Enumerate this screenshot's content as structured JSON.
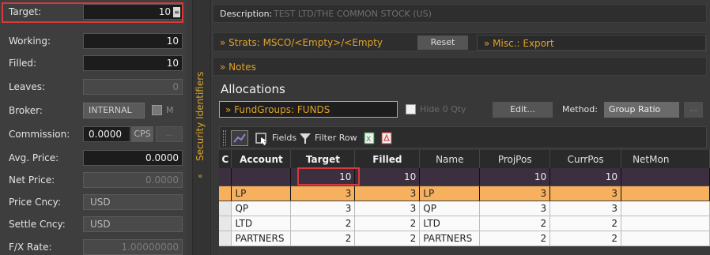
{
  "left_panel": {
    "target": {
      "label": "Target:",
      "value": "10",
      "btn": "≡"
    },
    "working": {
      "label": "Working:",
      "value": "10"
    },
    "filled": {
      "label": "Filled:",
      "value": "10"
    },
    "leaves": {
      "label": "Leaves:",
      "value": "0"
    },
    "broker": {
      "label": "Broker:",
      "value": "INTERNAL",
      "checkbox_label": "M"
    },
    "commission": {
      "label": "Commission:",
      "value": "0.0000",
      "unit": "CPS",
      "more": "..."
    },
    "avg_price": {
      "label": "Avg. Price:",
      "value": "0.0000"
    },
    "net_price": {
      "label": "Net Price:",
      "value": "0.0000"
    },
    "price_ccy": {
      "label": "Price Cncy:",
      "value": "USD"
    },
    "settle_ccy": {
      "label": "Settle Cncy:",
      "value": "USD"
    },
    "fx_rate": {
      "label": "F/X Rate:",
      "value": "1.00000000"
    }
  },
  "side_strip": {
    "label": "Security Identifiers",
    "chevron": "»"
  },
  "description": {
    "label": "Description:",
    "value": "TEST LTD/THE COMMON STOCK (US)"
  },
  "strats": {
    "text": "» Strats: MSCO/<Empty>/<Empty",
    "reset": "Reset",
    "misc": "» Misc.: Export"
  },
  "notes": {
    "text": "» Notes"
  },
  "allocations": {
    "title": "Allocations",
    "fund_groups": "» FundGroups: FUNDS",
    "hide_zero": "Hide 0 Qty",
    "edit": "Edit...",
    "method_label": "Method:",
    "method_value": "Group Ratio",
    "method_more": "...",
    "toolbar": {
      "fields": "Fields",
      "filter_row": "Filter Row"
    },
    "columns": [
      "C",
      "Account",
      "Target",
      "Filled",
      "Name",
      "ProjPos",
      "CurrPos",
      "NetMon"
    ],
    "totals": {
      "target": "10",
      "filled": "10",
      "projpos": "10",
      "currpos": "10"
    },
    "rows": [
      {
        "account": "LP",
        "target": "3",
        "filled": "3",
        "name": "LP",
        "projpos": "3",
        "currpos": "3"
      },
      {
        "account": "QP",
        "target": "3",
        "filled": "3",
        "name": "QP",
        "projpos": "3",
        "currpos": "3"
      },
      {
        "account": "LTD",
        "target": "2",
        "filled": "2",
        "name": "LTD",
        "projpos": "2",
        "currpos": "2"
      },
      {
        "account": "PARTNERS",
        "target": "2",
        "filled": "2",
        "name": "PARTNERS",
        "projpos": "2",
        "currpos": "2"
      }
    ]
  },
  "colors": {
    "accent": "#e0a226",
    "highlight": "#d63a3a",
    "selected_row": "#f6b05e"
  }
}
